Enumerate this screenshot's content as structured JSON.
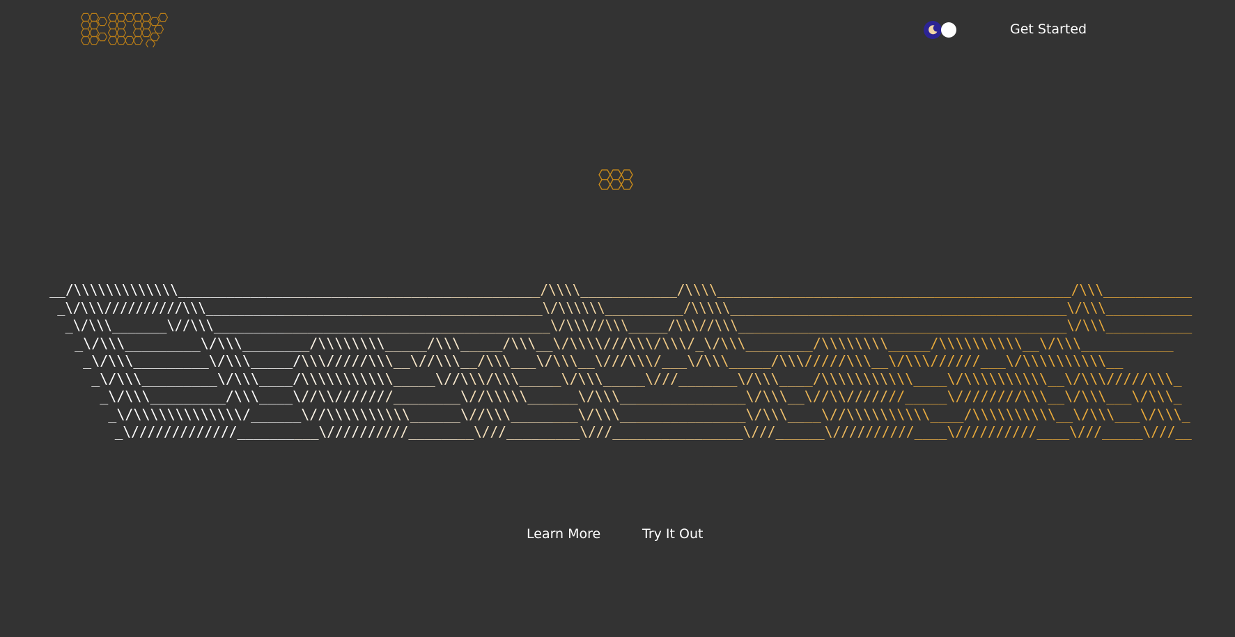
{
  "brand": {
    "logo_icon": "hexagon-wordmark-logo",
    "accent_color": "#c98a1a"
  },
  "header": {
    "theme_toggle": {
      "icon": "moon-icon",
      "state": "dark"
    },
    "get_started_label": "Get Started"
  },
  "hero": {
    "mark_icon": "hexagon-cluster-icon",
    "ascii_colors": {
      "start": "#ffffff",
      "end": "#e8a93a"
    },
    "ascii_lines": [
      "__/\\\\\\\\\\\\\\\\\\\\\\\\\\_____________________________________________/\\\\\\\\____________/\\\\\\\\____________________________________________/\\\\\\___________",
      " _\\/\\\\\\//////////\\\\\\___________________________________________\\/\\\\\\\\\\\\__________/\\\\\\\\\\___________________________________________\\/\\\\\\___________",
      "  _\\/\\\\\\_______\\//\\\\\\___________________________________________\\/\\\\\\//\\\\\\_____/\\\\\\//\\\\\\__________________________________________\\/\\\\\\___________",
      "   _\\/\\\\\\_________\\/\\\\\\________/\\\\\\\\\\\\\\\\_____/\\\\\\_____/\\\\\\__\\/\\\\\\\\///\\\\\\/\\\\\\/_\\/\\\\\\________/\\\\\\\\\\\\\\\\_____/\\\\\\\\\\\\\\\\\\\\__\\/\\\\\\___________",
      "    _\\/\\\\\\_________\\/\\\\\\_____/\\\\\\/////\\\\\\__\\//\\\\\\__/\\\\\\___\\/\\\\\\__\\///\\\\\\/___\\/\\\\\\_____/\\\\\\/////\\\\\\__\\/\\\\\\//////___\\/\\\\\\\\\\\\\\\\\\\\__",
      "     _\\/\\\\\\_________\\/\\\\\\____/\\\\\\\\\\\\\\\\\\\\\\_____\\//\\\\\\/\\\\\\_____\\/\\\\\\_____\\///_______\\/\\\\\\____/\\\\\\\\\\\\\\\\\\\\\\____\\/\\\\\\\\\\\\\\\\\\\\__\\/\\\\\\/////\\\\\\_",
      "      _\\/\\\\\\_________/\\\\\\____\\//\\\\///////________\\//\\\\\\\\\\______\\/\\\\\\_______________\\/\\\\\\__\\//\\\\///////_____\\////////\\\\\\__\\/\\\\\\___\\/\\\\\\_",
      "       _\\/\\\\\\\\\\\\\\\\\\\\\\\\\\/______\\//\\\\\\\\\\\\\\\\\\\\______\\//\\\\\\________\\/\\\\\\_______________\\/\\\\\\____\\//\\\\\\\\\\\\\\\\\\\\____/\\\\\\\\\\\\\\\\\\\\__\\/\\\\\\___\\/\\\\\\_",
      "        _\\/////////////__________\\//////////________\\///_________\\///________________\\///______\\//////////____\\//////////____\\///_____\\///__"
    ]
  },
  "actions": {
    "learn_more_label": "Learn More",
    "try_it_out_label": "Try It Out"
  }
}
